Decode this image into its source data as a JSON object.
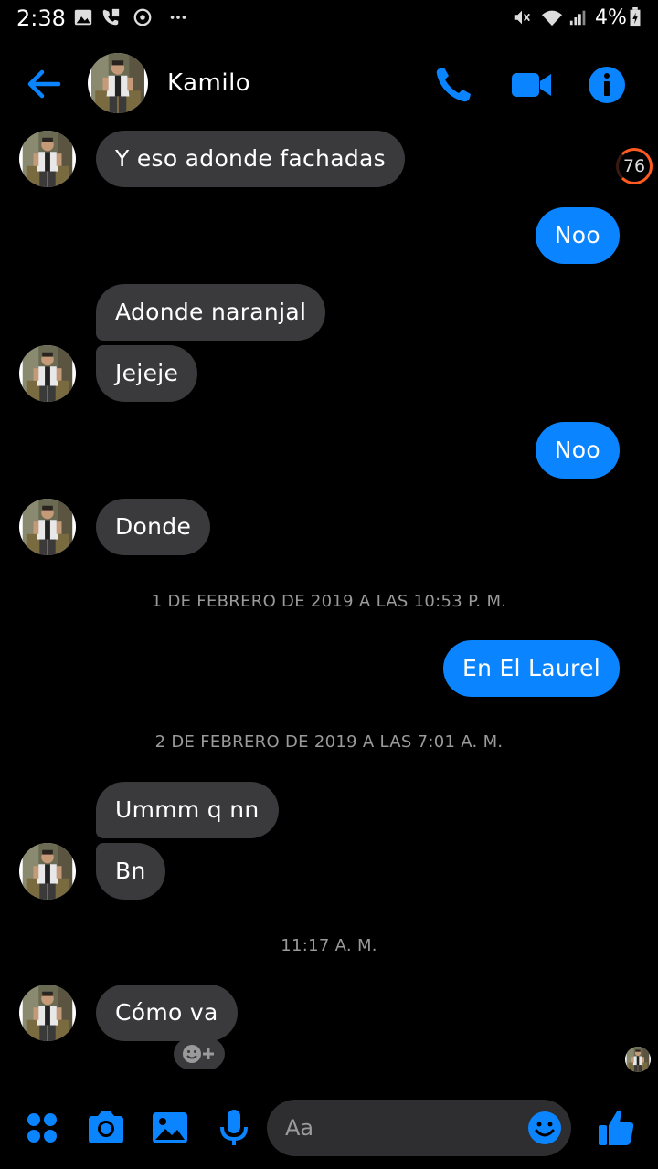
{
  "status_bar": {
    "time": "2:38",
    "battery": "4%"
  },
  "header": {
    "contact_name": "Kamilo"
  },
  "unread_badge": "76",
  "messages": [
    {
      "text": "Y eso adonde fachadas"
    },
    {
      "text": "Noo"
    },
    {
      "text": "Adonde naranjal"
    },
    {
      "text": "Jejeje"
    },
    {
      "text": "Noo"
    },
    {
      "text": "Donde"
    },
    {
      "text": "En El Laurel"
    },
    {
      "text": "Ummm q nn"
    },
    {
      "text": "Bn"
    },
    {
      "text": "Cómo va"
    }
  ],
  "timestamps": [
    "1 DE FEBRERO DE 2019 A LAS 10:53 P. M.",
    "2 DE FEBRERO DE 2019 A LAS 7:01 A. M.",
    "11:17 A. M."
  ],
  "composer": {
    "placeholder": "Aa"
  },
  "colors": {
    "accent": "#0a84ff",
    "incoming_bubble": "#3a3a3c",
    "background": "#000000"
  },
  "icons": [
    "back-arrow-icon",
    "phone-icon",
    "video-camera-icon",
    "info-icon",
    "apps-icon",
    "camera-icon",
    "gallery-icon",
    "microphone-icon",
    "emoji-icon",
    "thumbs-up-icon",
    "add-reaction-icon"
  ]
}
